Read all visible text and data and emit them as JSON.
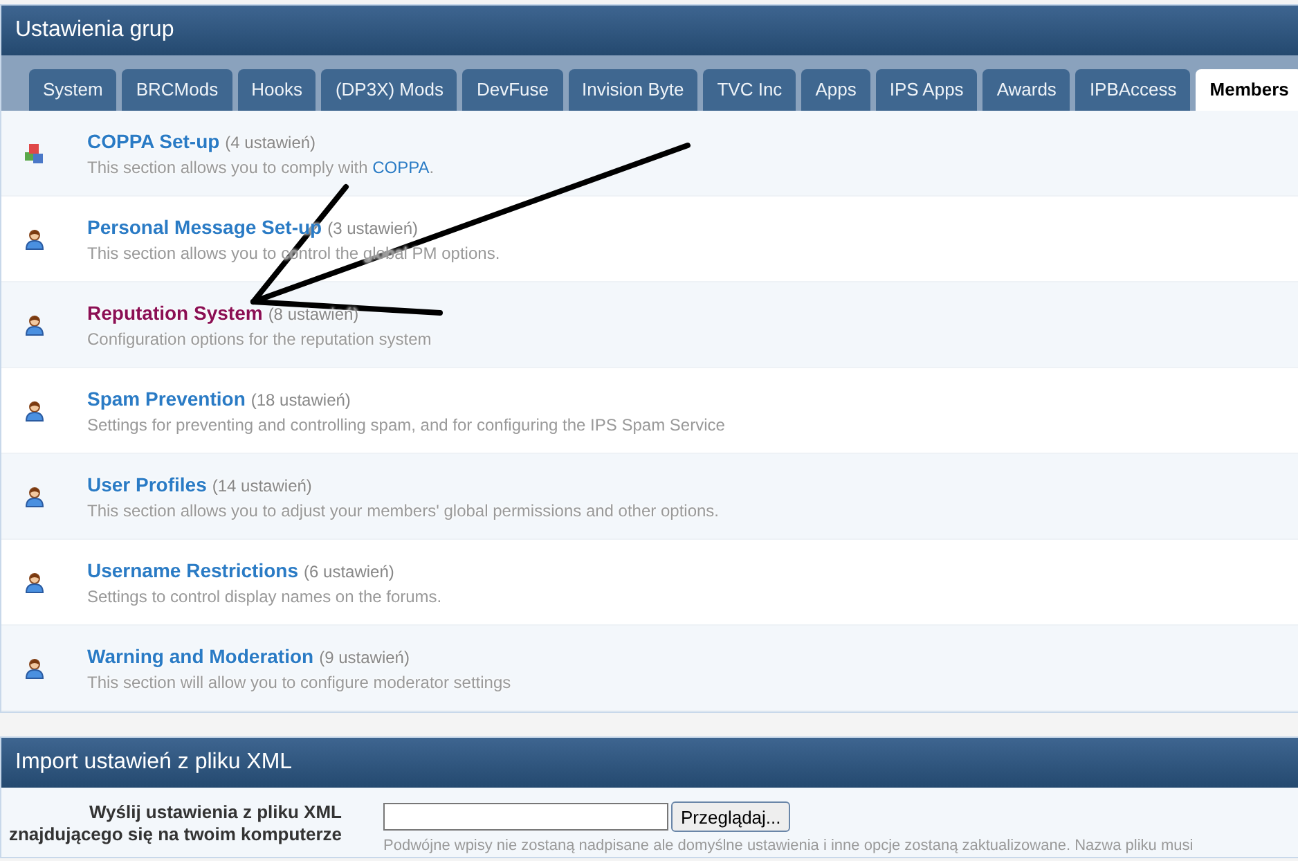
{
  "panel": {
    "title": "Ustawienia grup"
  },
  "tabs": [
    {
      "label": "System",
      "selected": false
    },
    {
      "label": "BRCMods",
      "selected": false
    },
    {
      "label": "Hooks",
      "selected": false
    },
    {
      "label": "(DP3X) Mods",
      "selected": false
    },
    {
      "label": "DevFuse",
      "selected": false
    },
    {
      "label": "Invision Byte",
      "selected": false
    },
    {
      "label": "TVC Inc",
      "selected": false
    },
    {
      "label": "Apps",
      "selected": false
    },
    {
      "label": "IPS Apps",
      "selected": false
    },
    {
      "label": "Awards",
      "selected": false
    },
    {
      "label": "IPBAccess",
      "selected": false
    },
    {
      "label": "Members",
      "selected": true
    }
  ],
  "groups": [
    {
      "kind": "cubes",
      "title": "COPPA Set-up",
      "count": "(4 ustawień)",
      "description": "This section allows you to comply with",
      "link": "COPPA",
      "after_link": ".",
      "visited": false
    },
    {
      "kind": "user",
      "title": "Personal Message Set-up",
      "count": "(3 ustawień)",
      "description": "This section allows you to control the global PM options.",
      "visited": false
    },
    {
      "kind": "user",
      "title": "Reputation System",
      "count": "(8 ustawień)",
      "description": "Configuration options for the reputation system",
      "visited": true
    },
    {
      "kind": "user",
      "title": "Spam Prevention",
      "count": "(18 ustawień)",
      "description": "Settings for preventing and controlling spam, and for configuring the IPS Spam Service",
      "visited": false
    },
    {
      "kind": "user",
      "title": "User Profiles",
      "count": "(14 ustawień)",
      "description": "This section allows you to adjust your members' global permissions and other options.",
      "visited": false
    },
    {
      "kind": "user",
      "title": "Username Restrictions",
      "count": "(6 ustawień)",
      "description": "Settings to control display names on the forums.",
      "visited": false
    },
    {
      "kind": "user",
      "title": "Warning and Moderation",
      "count": "(9 ustawień)",
      "description": "This section will allow you to configure moderator settings",
      "visited": false
    }
  ],
  "import": {
    "title": "Import ustawień z pliku XML",
    "label": "Wyślij ustawienia z pliku XML znajdującego się na twoim komputerze",
    "browse_button": "Przeglądaj...",
    "hint": "Podwójne wpisy nie zostaną nadpisane ale domyślne ustawienia i inne opcje zostaną zaktualizowane. Nazwa pliku musi"
  }
}
